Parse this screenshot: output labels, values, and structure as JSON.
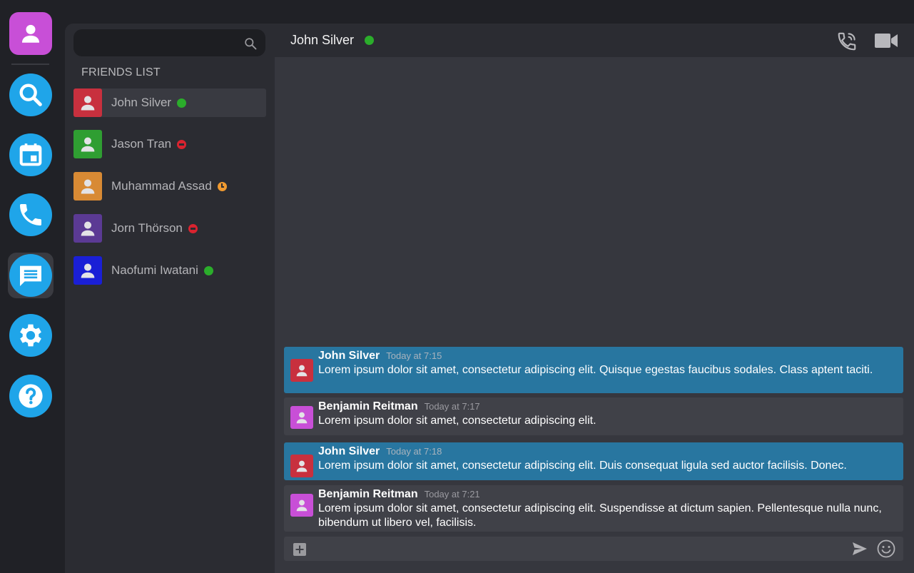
{
  "user": {
    "avatar_color": "#c84fd7"
  },
  "rail": {
    "items": [
      {
        "name": "search",
        "icon": "search-icon"
      },
      {
        "name": "calendar",
        "icon": "calendar-icon"
      },
      {
        "name": "calls",
        "icon": "phone-icon"
      },
      {
        "name": "messages",
        "icon": "chat-icon",
        "active": true
      },
      {
        "name": "settings",
        "icon": "gear-icon"
      },
      {
        "name": "help",
        "icon": "question-icon"
      }
    ],
    "accent": "#1fa5e9"
  },
  "search": {
    "placeholder": "",
    "value": ""
  },
  "friends": {
    "title": "FRIENDS LIST",
    "items": [
      {
        "name": "John Silver",
        "color": "#c8303e",
        "status": "online"
      },
      {
        "name": "Jason Tran",
        "color": "#2f9e32",
        "status": "dnd"
      },
      {
        "name": "Muhammad Assad",
        "color": "#d88a34",
        "status": "away"
      },
      {
        "name": "Jorn Thörson",
        "color": "#5b3a94",
        "status": "dnd"
      },
      {
        "name": "Naofumi Iwatani",
        "color": "#1a1fd6",
        "status": "online"
      }
    ]
  },
  "chat": {
    "title": "John Silver",
    "status": "online",
    "messages": [
      {
        "author": "John Silver",
        "time": "Today at 7:15",
        "text": "Lorem ipsum dolor sit amet, consectetur adipiscing elit. Quisque egestas faucibus sodales. Class aptent taciti.",
        "mine": true,
        "color": "#c8303e"
      },
      {
        "author": "Benjamin Reitman",
        "time": "Today at 7:17",
        "text": "Lorem ipsum dolor sit amet, consectetur adipiscing elit.",
        "mine": false,
        "color": "#c84fd7"
      },
      {
        "author": "John Silver",
        "time": "Today at 7:18",
        "text": "Lorem ipsum dolor sit amet, consectetur adipiscing elit. Duis consequat ligula sed auctor facilisis. Donec.",
        "mine": true,
        "color": "#c8303e"
      },
      {
        "author": "Benjamin Reitman",
        "time": "Today at 7:21",
        "text": "Lorem ipsum dolor sit amet, consectetur adipiscing elit. Suspendisse at dictum sapien. Pellentesque nulla nunc, bibendum ut libero vel, facilisis.",
        "mine": false,
        "color": "#c84fd7"
      }
    ]
  },
  "composer": {
    "placeholder": "",
    "value": ""
  }
}
